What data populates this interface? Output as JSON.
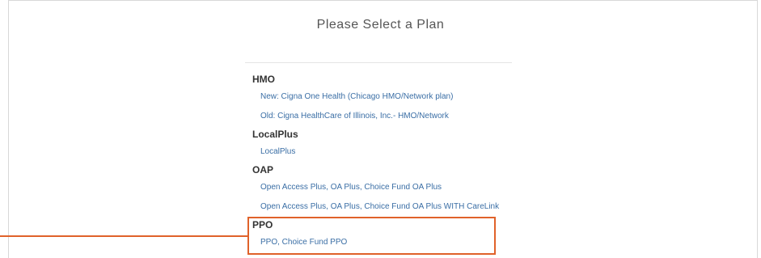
{
  "header": {
    "title": "Please Select a Plan"
  },
  "groups": [
    {
      "heading": "HMO",
      "plans": [
        "New: Cigna One Health (Chicago HMO/Network plan)",
        "Old: Cigna HealthCare of Illinois, Inc.- HMO/Network"
      ]
    },
    {
      "heading": "LocalPlus",
      "plans": [
        "LocalPlus"
      ]
    },
    {
      "heading": "OAP",
      "plans": [
        "Open Access Plus, OA Plus, Choice Fund OA Plus",
        "Open Access Plus, OA Plus, Choice Fund OA Plus WITH CareLink"
      ]
    },
    {
      "heading": "PPO",
      "plans": [
        "PPO, Choice Fund PPO"
      ]
    }
  ],
  "colors": {
    "link": "#3a6ea5",
    "highlight": "#e0622a",
    "heading": "#333333"
  }
}
